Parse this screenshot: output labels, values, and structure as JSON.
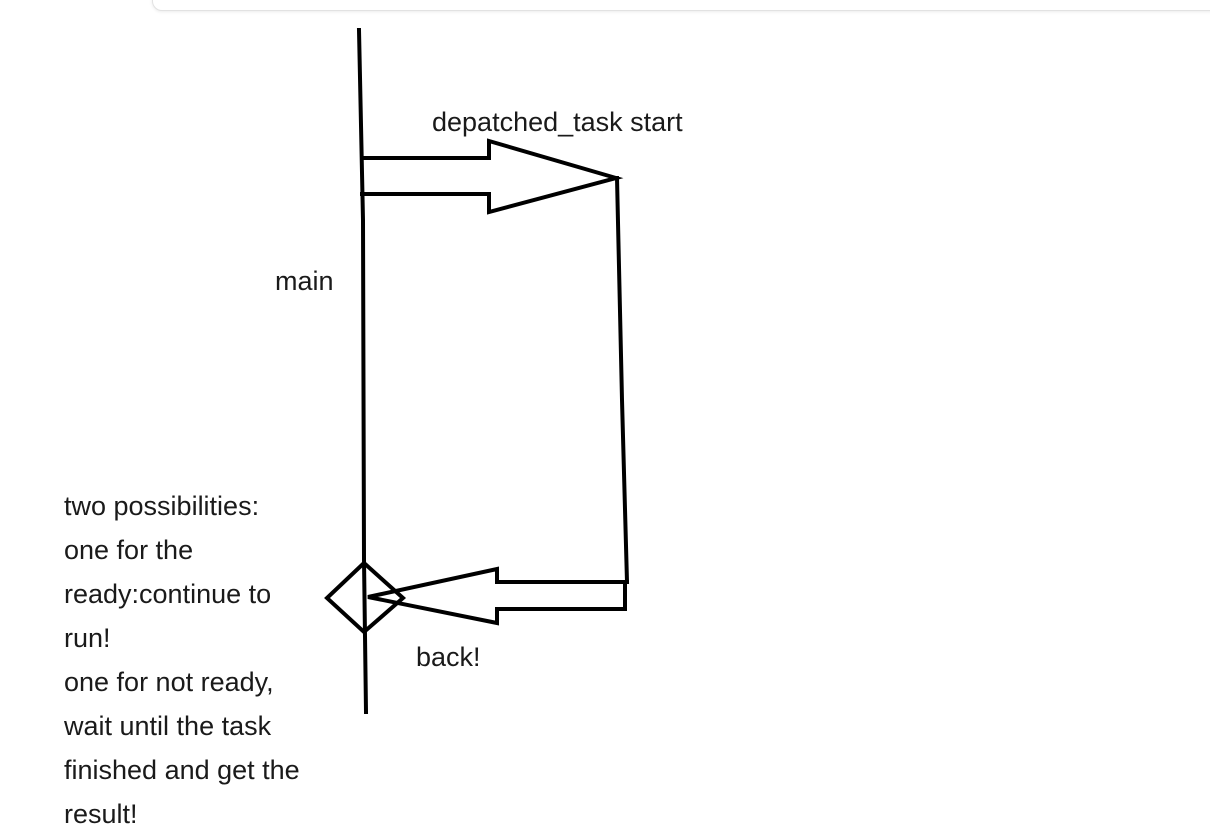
{
  "labels": {
    "task_start": "depatched_task start",
    "main": "main",
    "back": "back!"
  },
  "note_lines": [
    "two possibilities:",
    "one for the",
    "ready:continue to",
    "run!",
    "one for not ready,",
    "wait until the task",
    "finished and get the",
    "result!"
  ],
  "colors": {
    "stroke": "#000000",
    "text": "#1a1a1a",
    "background": "#ffffff"
  }
}
